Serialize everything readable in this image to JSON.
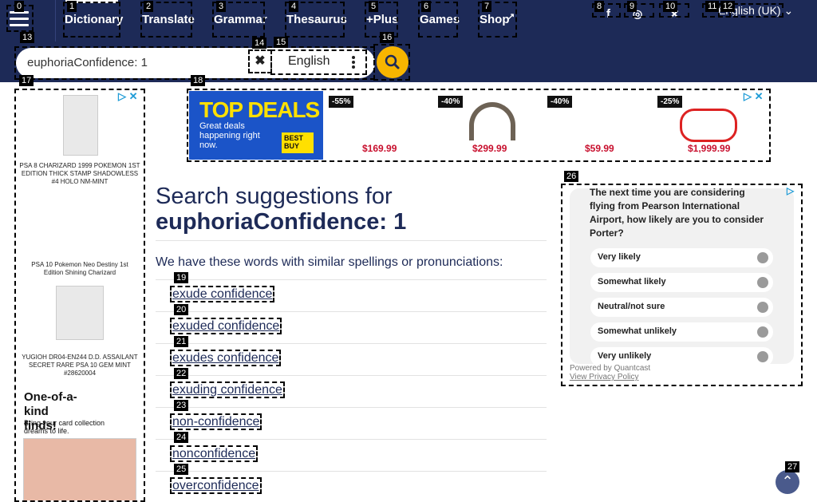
{
  "nav": {
    "items": [
      "Dictionary",
      "Translate",
      "Grammar",
      "Thesaurus",
      "+Plus",
      "Games",
      "Shop"
    ],
    "language": "English (UK)"
  },
  "search": {
    "value": "euphoriaConfidence: 1",
    "language": "English"
  },
  "markers": [
    "0",
    "1",
    "2",
    "3",
    "4",
    "5",
    "6",
    "7",
    "8",
    "9",
    "10",
    "11",
    "12",
    "13",
    "14",
    "15",
    "16",
    "17",
    "18",
    "19",
    "20",
    "21",
    "22",
    "23",
    "24",
    "25",
    "26",
    "27"
  ],
  "ads": {
    "left": {
      "card1": "PSA 8 CHARIZARD 1999 POKEMON 1ST EDITION THICK STAMP SHADOWLESS #4 HOLO NM-MINT",
      "card2": "PSA 10 Pokemon Neo Destiny 1st Edition Shining Charizard",
      "card3": "YUGIOH DR04-EN244 D.D. ASSAILANT SECRET RARE PSA 10 GEM MINT #28620004",
      "promo_title": "One-of-a-kind finds!",
      "promo_sub": "Bring your card collection dreams to life."
    },
    "top": {
      "headline": "TOP DEALS",
      "sub": "Great deals happening right now.",
      "logo": "BEST BUY",
      "deals": [
        {
          "pct": "-55%",
          "price": "$169.99"
        },
        {
          "pct": "-40%",
          "price": "$299.99"
        },
        {
          "pct": "-40%",
          "price": "$59.99"
        },
        {
          "pct": "-25%",
          "price": "$1,999.99"
        }
      ]
    }
  },
  "results": {
    "title_prefix": "Search suggestions for",
    "title_query": "euphoriaConfidence: 1",
    "intro": "We have these words with similar spellings or pronunciations:",
    "suggestions": [
      "exude confidence",
      "exuded confidence",
      "exudes confidence",
      "exuding confidence",
      "non-confidence",
      "nonconfidence",
      "overconfidence"
    ]
  },
  "survey": {
    "question": "The next time you are considering flying from Pearson International Airport, how likely are you to consider Porter?",
    "options": [
      "Very likely",
      "Somewhat likely",
      "Neutral/not sure",
      "Somewhat unlikely",
      "Very unlikely"
    ],
    "powered": "Powered by Quantcast",
    "privacy": "View Privacy Policy"
  }
}
